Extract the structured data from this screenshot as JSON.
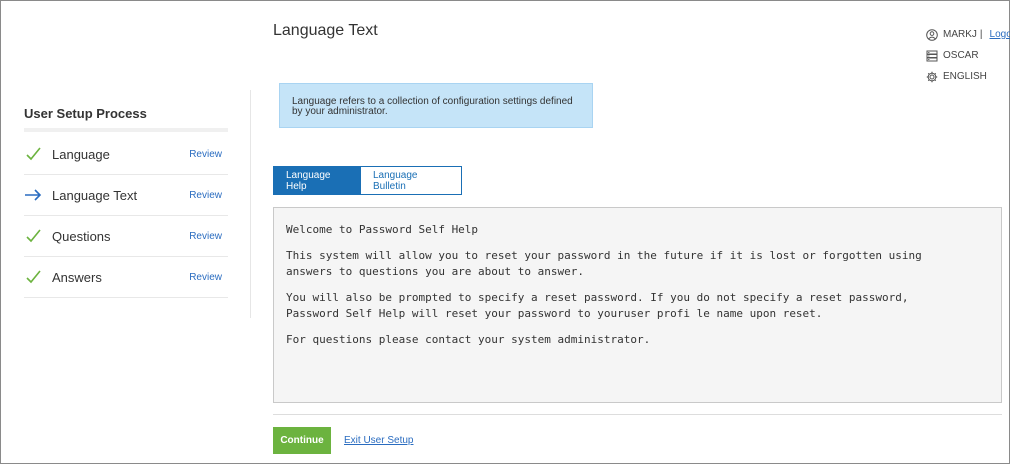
{
  "page_title": "Language Text",
  "user": {
    "username": "MARKJ",
    "separator": "|",
    "logout_label": "Logout",
    "server": "OSCAR",
    "language": "ENGLISH"
  },
  "sidebar": {
    "title": "User Setup Process",
    "steps": [
      {
        "label": "Language",
        "review": "Review",
        "status": "done",
        "icon": "check-icon"
      },
      {
        "label": "Language Text",
        "review": "Review",
        "status": "current",
        "icon": "arrow-right-icon"
      },
      {
        "label": "Questions",
        "review": "Review",
        "status": "done",
        "icon": "check-icon"
      },
      {
        "label": "Answers",
        "review": "Review",
        "status": "done",
        "icon": "check-icon"
      }
    ]
  },
  "info": {
    "line1": "Language refers to a collection of configuration settings defined",
    "line2": "by your administrator."
  },
  "tabs": [
    {
      "label": "Language Help",
      "active": true
    },
    {
      "label": "Language Bulletin",
      "active": false
    }
  ],
  "content": {
    "p1": "Welcome to Password Self Help",
    "p2": "This system will allow you to reset your password in the future if it is lost or forgotten using\nanswers to questions you are about to answer.",
    "p3": "You will also be prompted to specify a reset password. If you do not specify a reset password,\nPassword Self Help will reset your password to youruser profi le name upon reset.",
    "p4": "For questions please contact your system administrator."
  },
  "footer": {
    "continue_label": "Continue",
    "exit_label": "Exit User Setup"
  },
  "colors": {
    "check": "#6cb33f",
    "arrow": "#2a6cc0",
    "primary": "#1a6fb5",
    "continue": "#6cb33f",
    "info_bg": "#c5e4f8"
  }
}
